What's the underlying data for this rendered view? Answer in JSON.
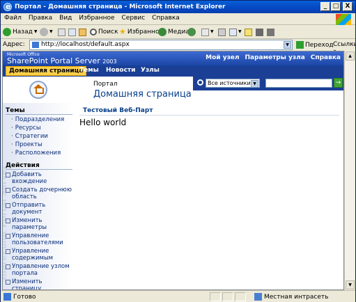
{
  "window": {
    "title": "Портал - Домашняя страница - Microsoft Internet Explorer",
    "min": "_",
    "max": "□",
    "close": "X"
  },
  "menu": [
    "Файл",
    "Правка",
    "Вид",
    "Избранное",
    "Сервис",
    "Справка"
  ],
  "toolbar": {
    "back": "Назад",
    "search": "Поиск",
    "favorites": "Избранное",
    "media": "Медиа"
  },
  "address": {
    "label": "Адрес:",
    "url": "http://localhost/default.aspx",
    "go": "Переход",
    "links": "Ссылки"
  },
  "sharepoint": {
    "logo_small": "Microsoft Office",
    "logo_main": "SharePoint Portal Server",
    "logo_year": "2003",
    "top_links": [
      "Мой узел",
      "Параметры узла",
      "Справка"
    ],
    "tabs": [
      "Домашняя страница",
      "Темы",
      "Новости",
      "Узлы"
    ],
    "breadcrumb": "Портал",
    "page_title": "Домашняя страница",
    "search_scope": "Все источники",
    "sidebar_watermark": "SharePoint Portal Server",
    "topics_header": "Темы",
    "topics": [
      "Подразделения",
      "Ресурсы",
      "Стратегии",
      "Проекты",
      "Расположения"
    ],
    "actions_header": "Действия",
    "actions": [
      "Добавить вхождение",
      "Создать дочернюю область",
      "Отправить документ",
      "Изменить параметры",
      "Управление пользователями",
      "Управление содержимым",
      "Управление узлом портала",
      "Изменить страницу"
    ],
    "webpart_title": "Тестовый Веб-Парт",
    "webpart_body": "Hello world"
  },
  "status": {
    "text": "Готово",
    "zone": "Местная интрасеть"
  }
}
